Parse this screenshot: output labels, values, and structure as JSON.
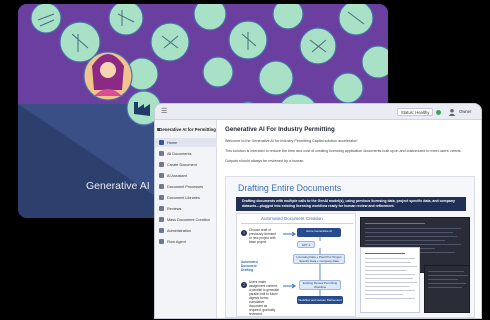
{
  "hero": {
    "title": "Generative AI",
    "colors": {
      "background": "#2d3f6c",
      "circles": "#a9e1c7",
      "accent_purple": "#6a3fa0"
    }
  },
  "app": {
    "topbar": {
      "menu_icon": "hamburger-icon",
      "status_label": "Status: Healthy",
      "user_icon": "user-icon",
      "user_name": "Owner"
    },
    "sidebar": {
      "header": "Generative AI for Permitting",
      "items": [
        {
          "label": "Home",
          "icon": "home-icon",
          "active": true
        },
        {
          "label": "All Documents",
          "icon": "documents-icon",
          "active": false
        },
        {
          "label": "Create Document",
          "icon": "create-document-icon",
          "active": false
        },
        {
          "label": "AI Assistant",
          "icon": "assistant-icon",
          "active": false
        },
        {
          "label": "Document Processes",
          "icon": "process-icon",
          "active": false
        },
        {
          "label": "Document Libraries",
          "icon": "library-icon",
          "active": false
        },
        {
          "label": "Reviews",
          "icon": "review-icon",
          "active": false
        },
        {
          "label": "Mass Document Creation",
          "icon": "mass-create-icon",
          "active": false
        },
        {
          "label": "Administration",
          "icon": "admin-icon",
          "active": false
        },
        {
          "label": "Flow Agent",
          "icon": "agent-icon",
          "active": false
        }
      ]
    },
    "main": {
      "title": "Generative AI For Industry Permitting",
      "paragraphs": [
        "Welcome to the Generative AI for Industry Permitting Capital solution accelerator!",
        "This solution is intended to reduce the time and cost of creating licensing application documents built upon and customized to meet users' needs.",
        "Outputs should always be reviewed by a human."
      ],
      "slide": {
        "title": "Drafting Entire Documents",
        "banner": "Drafting documents with multiple calls to the GenAI model(s), using previous licensing data, project specific data, and company datasets—plugged into existing licensing workflow ready for human review and refinement.",
        "panel_title": "Automated Document Creation",
        "side_label": "Automated Document Drafting",
        "steps": [
          {
            "num": "1",
            "text": "Choose draft of previously licensed or new project with base project"
          },
          {
            "num": "2",
            "text": "Users make assignment content; a parallel to generate parallel edit to future digests forms; cumulative document as required, gradually reviewed."
          }
        ],
        "flow": [
          "Azure Generative AI",
          "GPT 4",
          "Licensing Data + Past Prior Project Specific Data + Company Data",
          "Existing Review Permitting Workflow",
          "Workflow and Human Refinement"
        ]
      }
    }
  }
}
